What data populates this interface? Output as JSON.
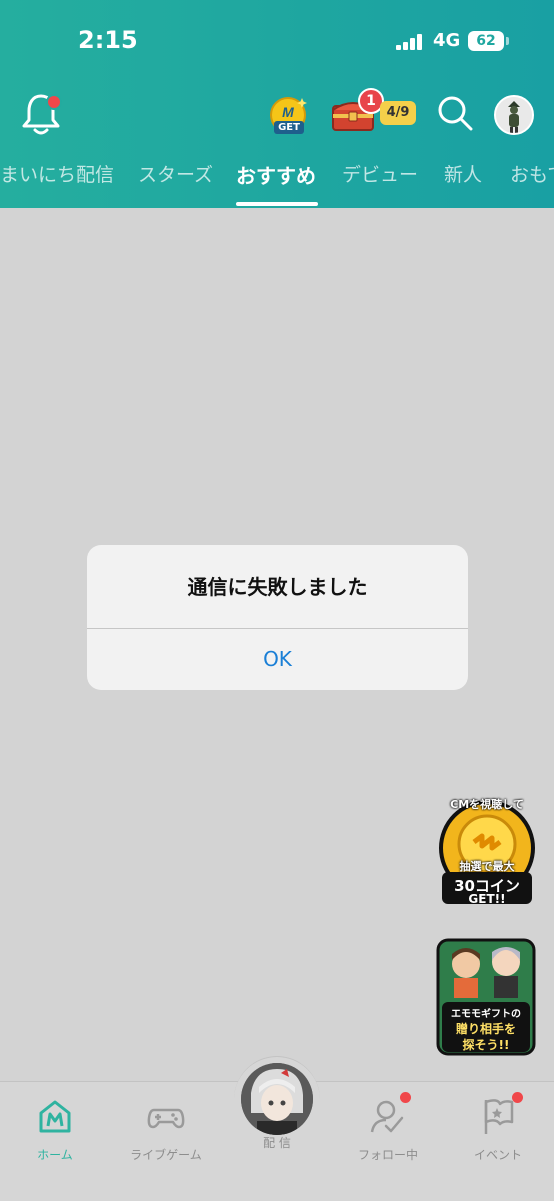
{
  "status_bar": {
    "time": "2:15",
    "network": "4G",
    "battery": "62"
  },
  "header": {
    "coin_label": "GET",
    "chest_badge": "1",
    "chest_progress": "4/9"
  },
  "tabs": [
    {
      "label": "まいにち配信"
    },
    {
      "label": "スターズ"
    },
    {
      "label": "おすすめ",
      "active": true
    },
    {
      "label": "デビュー"
    },
    {
      "label": "新人"
    },
    {
      "label": "おもて"
    }
  ],
  "dialog": {
    "message": "通信に失敗しました",
    "ok_label": "OK"
  },
  "promos": {
    "cm_banner": {
      "line1": "CMを視聴して",
      "line2": "抽選で最大",
      "line3": "30コイン",
      "line4": "GET!!"
    },
    "gift_banner": {
      "line1": "エモモギフトの",
      "line2": "贈り相手を",
      "line3": "探そう!!"
    }
  },
  "bottom_nav": [
    {
      "label": "ホーム",
      "icon": "home-icon",
      "active": true
    },
    {
      "label": "ライブゲーム",
      "icon": "gamepad-icon"
    },
    {
      "label": "配 信",
      "icon": "broadcast-avatar"
    },
    {
      "label": "フォロー中",
      "icon": "follow-icon"
    },
    {
      "label": "イベント",
      "icon": "flag-icon"
    }
  ],
  "colors": {
    "accent": "#1fa7a0",
    "background": "#d3d3d3",
    "badge": "#f0474a",
    "link": "#1a7fd6"
  }
}
